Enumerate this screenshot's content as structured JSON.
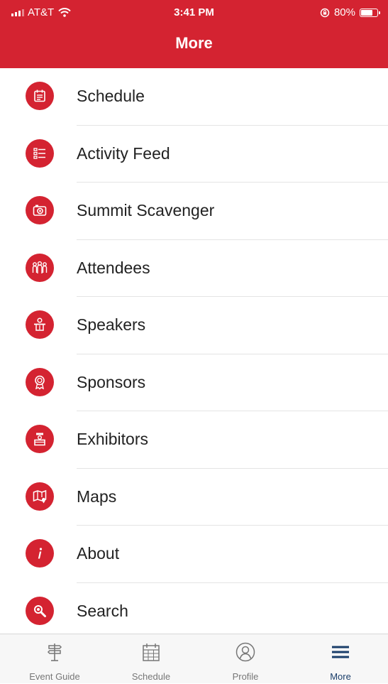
{
  "status_bar": {
    "carrier": "AT&T",
    "time": "3:41 PM",
    "battery_text": "80%",
    "battery_level": 0.8
  },
  "header": {
    "title": "More"
  },
  "menu": {
    "items": [
      {
        "label": "Schedule",
        "icon": "calendar-icon"
      },
      {
        "label": "Activity Feed",
        "icon": "feed-list-icon"
      },
      {
        "label": "Summit Scavenger",
        "icon": "camera-icon"
      },
      {
        "label": "Attendees",
        "icon": "people-icon"
      },
      {
        "label": "Speakers",
        "icon": "podium-speaker-icon"
      },
      {
        "label": "Sponsors",
        "icon": "award-ribbon-icon"
      },
      {
        "label": "Exhibitors",
        "icon": "exhibitor-booth-icon"
      },
      {
        "label": "Maps",
        "icon": "map-icon"
      },
      {
        "label": "About",
        "icon": "info-icon"
      },
      {
        "label": "Search",
        "icon": "search-icon"
      }
    ]
  },
  "tabbar": {
    "tabs": [
      {
        "label": "Event Guide",
        "icon": "signpost-icon",
        "active": false
      },
      {
        "label": "Schedule",
        "icon": "calendar-icon",
        "active": false
      },
      {
        "label": "Profile",
        "icon": "profile-icon",
        "active": false
      },
      {
        "label": "More",
        "icon": "hamburger-menu-icon",
        "active": true
      }
    ]
  },
  "colors": {
    "brand_red": "#d42331",
    "active_tab": "#1a3e6a",
    "inactive_tab": "#777777"
  }
}
